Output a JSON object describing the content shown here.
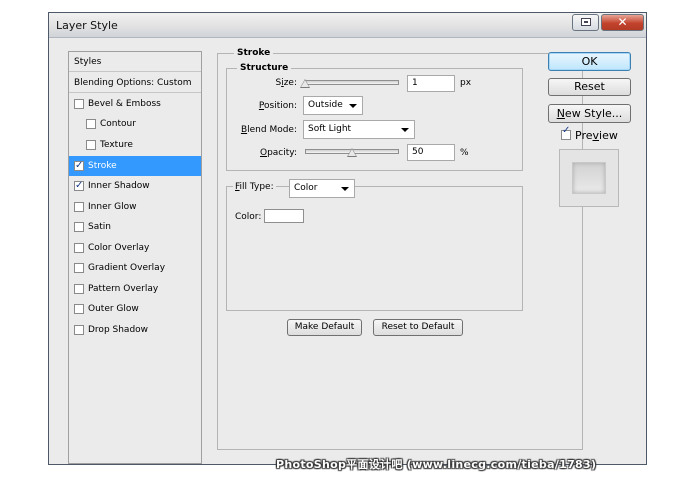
{
  "window": {
    "title": "Layer Style",
    "close_glyph": "✕"
  },
  "styles_list": {
    "header": "Styles",
    "blending": "Blending Options: Custom",
    "items": [
      {
        "label": "Bevel & Emboss",
        "checked": false
      },
      {
        "label": "Contour",
        "checked": false
      },
      {
        "label": "Texture",
        "checked": false
      },
      {
        "label": "Stroke",
        "checked": true,
        "selected": true
      },
      {
        "label": "Inner Shadow",
        "checked": true
      },
      {
        "label": "Inner Glow",
        "checked": false
      },
      {
        "label": "Satin",
        "checked": false
      },
      {
        "label": "Color Overlay",
        "checked": false
      },
      {
        "label": "Gradient Overlay",
        "checked": false
      },
      {
        "label": "Pattern Overlay",
        "checked": false
      },
      {
        "label": "Outer Glow",
        "checked": false
      },
      {
        "label": "Drop Shadow",
        "checked": false
      }
    ]
  },
  "stroke": {
    "title": "Stroke",
    "structure_title": "Structure",
    "size": {
      "label_pre": "S",
      "label_u": "i",
      "label_post": "ze:",
      "value": "1",
      "unit": "px",
      "slider_fraction": 0.0
    },
    "position": {
      "label_pre": "",
      "label_u": "P",
      "label_post": "osition:",
      "value": "Outside"
    },
    "blend_mode": {
      "label_pre": "",
      "label_u": "B",
      "label_post": "lend Mode:",
      "value": "Soft Light"
    },
    "opacity": {
      "label_pre": "",
      "label_u": "O",
      "label_post": "pacity:",
      "value": "50",
      "unit": "%",
      "slider_fraction": 0.5
    },
    "fill_type": {
      "label_pre": "",
      "label_u": "F",
      "label_post": "ill Type:",
      "value": "Color"
    },
    "color": {
      "label": "Color:",
      "value": "#ffffff"
    },
    "make_default": "Make Default",
    "reset_default": "Reset to Default"
  },
  "buttons": {
    "ok": "OK",
    "reset": "Reset",
    "new_style_u": "N",
    "new_style_rest": "ew Style...",
    "preview_pre": "Pre",
    "preview_u": "v",
    "preview_post": "iew",
    "preview_checked": true
  },
  "watermark": "PhotoShop平面设计吧 (www.linecg.com/tieba/1783)"
}
